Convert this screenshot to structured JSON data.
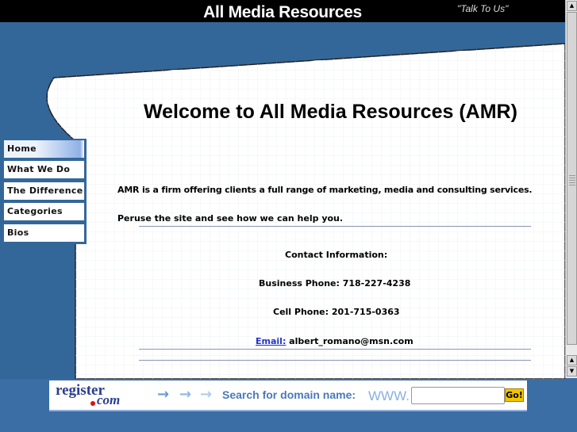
{
  "header": {
    "title": "All Media Resources",
    "tagline": "\"Talk To Us\""
  },
  "nav": {
    "items": [
      {
        "label": "Home"
      },
      {
        "label": "What We Do"
      },
      {
        "label": "The Difference"
      },
      {
        "label": "Categories"
      },
      {
        "label": "Bios"
      }
    ]
  },
  "main": {
    "heading": "Welcome to All Media Resources (AMR)",
    "intro": "AMR is a firm offering clients a full range of marketing, media and consulting services.",
    "peruse": "Peruse the site and see how we can help you.",
    "contact_heading": "Contact Information:",
    "business_phone": "Business Phone: 718-227-4238",
    "cell_phone": "Cell Phone: 201-715-0363",
    "email_label": "Email:",
    "email_value": " albert_romano@msn.com"
  },
  "banner": {
    "logo_text": "register",
    "logo_com": "com",
    "search_label": "Search for domain name:",
    "www": "WWW.",
    "input_value": "",
    "go_label": "Go!"
  }
}
